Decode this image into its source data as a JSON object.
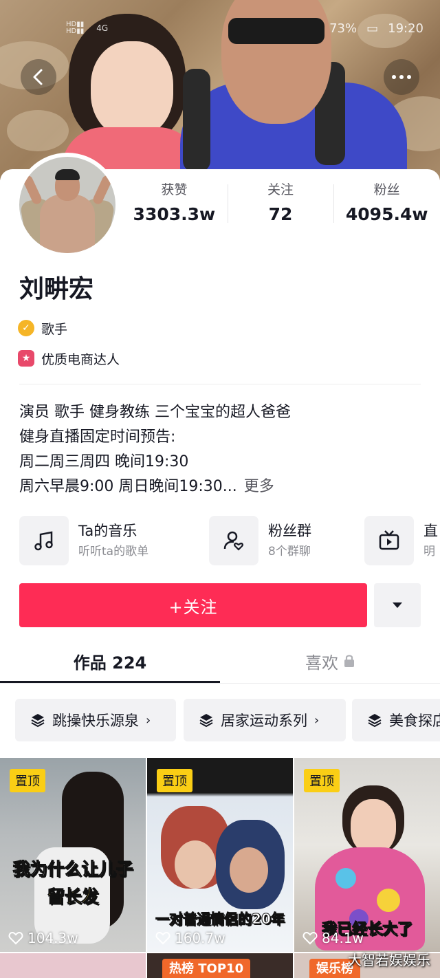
{
  "status_bar": {
    "network": "4G",
    "battery": "73%",
    "time": "19:20"
  },
  "profile": {
    "name": "刘畊宏",
    "tags": [
      "歌手",
      "优质电商达人"
    ],
    "stats": [
      {
        "label": "获赞",
        "value": "3303.3w"
      },
      {
        "label": "关注",
        "value": "72"
      },
      {
        "label": "粉丝",
        "value": "4095.4w"
      }
    ],
    "bio": [
      "演员 歌手 健身教练 三个宝宝的超人爸爸",
      "健身直播固定时间预告:",
      "周二周三周四 晚间19:30",
      "周六早晨9:00 周日晚间19:30..."
    ],
    "bio_more": "更多"
  },
  "entries": [
    {
      "title": "Ta的音乐",
      "subtitle": "听听ta的歌单",
      "icon": "music-note-icon"
    },
    {
      "title": "粉丝群",
      "subtitle": "8个群聊",
      "icon": "fan-group-icon"
    },
    {
      "title": "直",
      "subtitle": "明",
      "icon": "tv-icon"
    }
  ],
  "actions": {
    "follow_label": "+关注"
  },
  "tabs": [
    {
      "label": "作品 224",
      "active": true
    },
    {
      "label": "喜欢",
      "locked": true
    }
  ],
  "collections": [
    "跳操快乐源泉",
    "居家运动系列",
    "美食探店"
  ],
  "videos": [
    {
      "pinned": "置顶",
      "caption_lines": [
        "我为什么让儿子",
        "留长发"
      ],
      "likes": "104.3w"
    },
    {
      "pinned": "置顶",
      "caption_lines": [
        "一对普通情侣的20年"
      ],
      "likes": "160.7w"
    },
    {
      "pinned": "置顶",
      "caption_lines": [
        "我已经长大了"
      ],
      "likes": "84.1w"
    }
  ],
  "second_row_labels": [
    "",
    "热榜 TOP10",
    "娱乐榜"
  ],
  "watermark": "大智若娱娱乐",
  "colors": {
    "accent": "#fe2c55",
    "pin_badge": "#face15",
    "verify_badge": "#f5b527",
    "ecommerce_badge": "#e8496a"
  }
}
